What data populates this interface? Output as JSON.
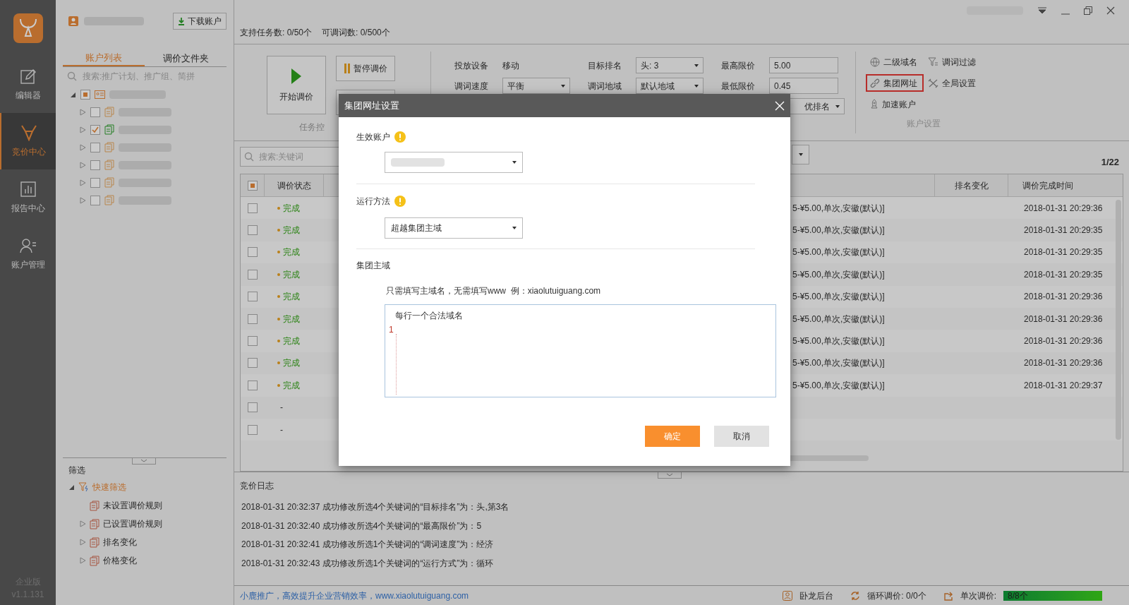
{
  "nav": {
    "items": [
      {
        "label": "编辑器",
        "selected": false
      },
      {
        "label": "竞价中心",
        "selected": true
      },
      {
        "label": "报告中心",
        "selected": false
      },
      {
        "label": "账户管理",
        "selected": false
      }
    ],
    "edition": "企业版",
    "version": "v1.1.131"
  },
  "account_panel": {
    "download_button": "下载账户",
    "tabs": [
      {
        "label": "账户列表",
        "selected": true
      },
      {
        "label": "调价文件夹",
        "selected": false
      }
    ],
    "search": {
      "placeholder": "搜索:推广计划、推广组、简拼"
    },
    "tree": {
      "partial": true,
      "expanded": true,
      "children": [
        {
          "checked": false,
          "expanded": false
        },
        {
          "checked": true,
          "expanded": false
        },
        {
          "checked": false,
          "expanded": false
        },
        {
          "checked": false,
          "expanded": false
        },
        {
          "checked": false,
          "expanded": false
        },
        {
          "checked": false,
          "expanded": false
        }
      ]
    },
    "filter": {
      "title": "筛选",
      "root": {
        "label": "快速筛选",
        "expanded": true,
        "children": [
          {
            "label": "未设置调价规则",
            "has_children": false
          },
          {
            "label": "已设置调价规则",
            "has_children": true
          },
          {
            "label": "排名变化",
            "has_children": true
          },
          {
            "label": "价格变化",
            "has_children": true
          }
        ]
      }
    }
  },
  "stats": [
    {
      "label": "支持任务数:",
      "value": "0/50个"
    },
    {
      "label": "可调词数:",
      "value": "0/500个"
    }
  ],
  "toolbar": {
    "start_button": "开始调价",
    "pause_button": "暂停调价",
    "task_group": "任务控",
    "settings": [
      {
        "label": "投放设备",
        "kind": "text",
        "value": "移动"
      },
      {
        "label": "调词速度",
        "kind": "select",
        "value": "平衡"
      },
      {
        "label": "目标排名",
        "kind": "select",
        "value": "头: 3"
      },
      {
        "label": "调词地域",
        "kind": "select",
        "value": "默认地域"
      },
      {
        "label": "最高限价",
        "kind": "input",
        "value": "5.00"
      },
      {
        "label": "最低限价",
        "kind": "input",
        "value": "0.45"
      }
    ],
    "cut_select": "优排名",
    "account_actions": [
      {
        "label": "二级域名",
        "selected": false
      },
      {
        "label": "调词过滤",
        "selected": false
      },
      {
        "label": "集团网址",
        "selected": true
      },
      {
        "label": "全局设置",
        "selected": false
      },
      {
        "label": "加速账户",
        "selected": false
      }
    ],
    "account_group": "账户设置"
  },
  "table": {
    "search": {
      "placeholder": "搜索:关键词"
    },
    "page": "1/22",
    "header_partial": true,
    "columns": [
      "调价状态",
      "排名变化",
      "调价完成时间"
    ],
    "rows": [
      {
        "checked": false,
        "status": "完成",
        "done": true,
        "detail": "5-¥5.00,单次,安徽(默认)]",
        "time": "2018-01-31 20:29:36"
      },
      {
        "checked": false,
        "status": "完成",
        "done": true,
        "detail": "5-¥5.00,单次,安徽(默认)]",
        "time": "2018-01-31 20:29:35"
      },
      {
        "checked": false,
        "status": "完成",
        "done": true,
        "detail": "5-¥5.00,单次,安徽(默认)]",
        "time": "2018-01-31 20:29:35"
      },
      {
        "checked": false,
        "status": "完成",
        "done": true,
        "detail": "5-¥5.00,单次,安徽(默认)]",
        "time": "2018-01-31 20:29:35"
      },
      {
        "checked": false,
        "status": "完成",
        "done": true,
        "detail": "5-¥5.00,单次,安徽(默认)]",
        "time": "2018-01-31 20:29:36"
      },
      {
        "checked": false,
        "status": "完成",
        "done": true,
        "detail": "5-¥5.00,单次,安徽(默认)]",
        "time": "2018-01-31 20:29:36"
      },
      {
        "checked": false,
        "status": "完成",
        "done": true,
        "detail": "5-¥5.00,单次,安徽(默认)]",
        "time": "2018-01-31 20:29:36"
      },
      {
        "checked": false,
        "status": "完成",
        "done": true,
        "detail": "5-¥5.00,单次,安徽(默认)]",
        "time": "2018-01-31 20:29:36"
      },
      {
        "checked": false,
        "status": "完成",
        "done": true,
        "detail": "5-¥5.00,单次,安徽(默认)]",
        "time": "2018-01-31 20:29:37"
      },
      {
        "checked": false,
        "status": "-",
        "done": false
      },
      {
        "checked": false,
        "status": "-",
        "done": false
      }
    ]
  },
  "log": {
    "title": "竞价日志",
    "lines": [
      "2018-01-31 20:32:37 成功修改所选4个关键词的“目标排名”为：头,第3名",
      "2018-01-31 20:32:40 成功修改所选4个关键词的“最高限价”为：5",
      "2018-01-31 20:32:41 成功修改所选1个关键词的“调词速度”为：经济",
      "2018-01-31 20:32:43 成功修改所选1个关键词的“运行方式”为：循环"
    ]
  },
  "status_bar": {
    "slogan": "小鹿推广，高效提升企业营销效率，www.xiaolutuiguang.com",
    "backend": "卧龙后台",
    "loop_label": "循环调价:",
    "loop_value": "0/0个",
    "single_label": "单次调价:",
    "single_value": "8/8个",
    "level": 1
  },
  "dialog": {
    "title": "集团网址设置",
    "account_label": "生效账户",
    "method_label": "运行方法",
    "method_value": "超越集团主域",
    "domain_label": "集团主域",
    "hint": "只需填写主域名，无需填写www  例：xiaolutuiguang.com",
    "placeholder": "每行一个合法域名",
    "line_number": "1",
    "ok": "确定",
    "cancel": "取消"
  }
}
